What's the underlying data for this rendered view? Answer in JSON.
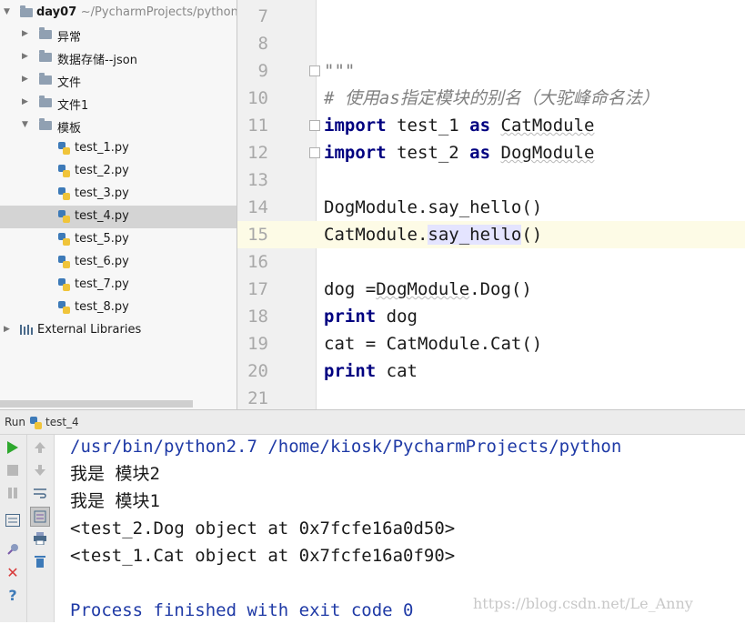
{
  "project": {
    "root_name": "day07",
    "root_path": "~/PycharmProjects/python",
    "folders": [
      "异常",
      "数据存储--json",
      "文件",
      "文件1",
      "模板"
    ],
    "files": [
      "test_1.py",
      "test_2.py",
      "test_3.py",
      "test_4.py",
      "test_5.py",
      "test_6.py",
      "test_7.py",
      "test_8.py"
    ],
    "selected_file": "test_4.py",
    "external": "External Libraries"
  },
  "editor": {
    "line_numbers": [
      "7",
      "8",
      "9",
      "10",
      "11",
      "12",
      "13",
      "14",
      "15",
      "16",
      "17",
      "18",
      "19",
      "20",
      "21"
    ],
    "current_line": "15",
    "lines": {
      "l9": "\"\"\"",
      "l10": "# 使用as指定模块的别名（大驼峰命名法）",
      "l11_kw1": "import",
      "l11_mod": " test_1 ",
      "l11_kw2": "as",
      "l11_alias": "CatModule",
      "l12_kw1": "import",
      "l12_mod": " test_2 ",
      "l12_kw2": "as",
      "l12_alias": "DogModule",
      "l14": "DogModule.say_hello()",
      "l15_a": "CatModule.",
      "l15_b": "say_hello",
      "l15_c": "()",
      "l17_a": "dog =",
      "l17_b": "DogModule",
      "l17_c": ".Dog()",
      "l18_kw": "print",
      "l18_rest": " dog",
      "l19": "cat = CatModule.Cat()",
      "l20_kw": "print",
      "l20_rest": " cat"
    }
  },
  "run": {
    "label": "Run",
    "config": "test_4",
    "output": [
      "/usr/bin/python2.7 /home/kiosk/PycharmProjects/python",
      "我是 模块2",
      "我是 模块1",
      "<test_2.Dog object at 0x7fcfe16a0d50>",
      "<test_1.Cat object at 0x7fcfe16a0f90>",
      "",
      "Process finished with exit code 0"
    ],
    "watermark": "https://blog.csdn.net/Le_Anny"
  },
  "colors": {
    "keyword": "#000080",
    "comment": "#808080",
    "console_blue": "#1f3aa6",
    "run_green": "#2ea82e",
    "close_red": "#d83a3a"
  }
}
